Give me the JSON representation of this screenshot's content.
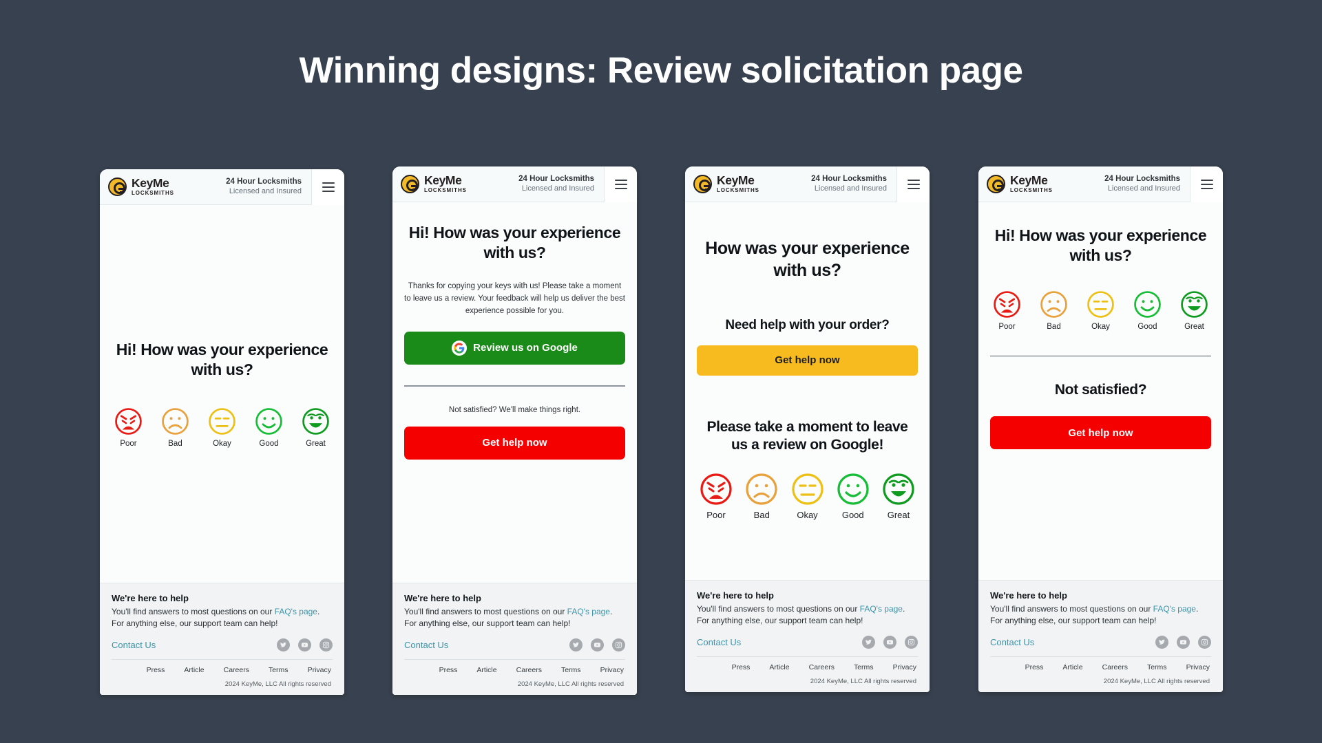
{
  "slide": {
    "title": "Winning designs: Review solicitation page",
    "background_color": "#38414f",
    "title_color": "#ffffff"
  },
  "brand": {
    "name": "KeyMe",
    "sub": "LOCKSMITHS",
    "logo_color": "#f2b929",
    "header_line1": "24 Hour Locksmiths",
    "header_line2": "Licensed and Insured",
    "menu_icon": "hamburger-menu-icon"
  },
  "ratings": [
    {
      "label": "Poor",
      "color": "#e81b14",
      "face": "angry"
    },
    {
      "label": "Bad",
      "color": "#e8a13c",
      "face": "sad"
    },
    {
      "label": "Okay",
      "color": "#edc016",
      "face": "neutral"
    },
    {
      "label": "Good",
      "color": "#17bd36",
      "face": "smile"
    },
    {
      "label": "Great",
      "color": "#0f9b20",
      "face": "grin"
    }
  ],
  "footer": {
    "title": "We're here to help",
    "copy_before": "You'll find answers to most questions on our ",
    "link1": "FAQ's page",
    "copy_after": ". For anything else, our support team can help!",
    "contact": "Contact Us",
    "socials": [
      "twitter-icon",
      "youtube-icon",
      "instagram-icon"
    ],
    "links": [
      "Press",
      "Article",
      "Careers",
      "Terms",
      "Privacy"
    ],
    "copyright": "2024 KeyMe, LLC All rights reserved"
  },
  "designs": [
    {
      "id": "design-1",
      "headline": "Hi! How was your experience with us?",
      "has_faces": true
    },
    {
      "id": "design-2",
      "headline": "Hi! How was your experience with us?",
      "paragraph": "Thanks for copying your keys with us! Please take a moment to leave us a review. Your feedback will help us deliver the best experience possible for you.",
      "google_button": "Review us on Google",
      "google_button_color": "#1a8a18",
      "not_satisfied": "Not satisfied? We'll make things right.",
      "help_button": "Get help now",
      "help_button_color": "#f40000"
    },
    {
      "id": "design-3",
      "headline": "How was your experience with us?",
      "need_help": "Need help with your order?",
      "help_button": "Get help now",
      "help_button_color": "#f7bb20",
      "review_prompt": "Please take a moment to leave us a review on Google!",
      "has_faces": true
    },
    {
      "id": "design-4",
      "headline": "Hi! How was your experience with us?",
      "has_faces": true,
      "not_satisfied": "Not satisfied?",
      "help_button": "Get help now",
      "help_button_color": "#f40000"
    }
  ]
}
